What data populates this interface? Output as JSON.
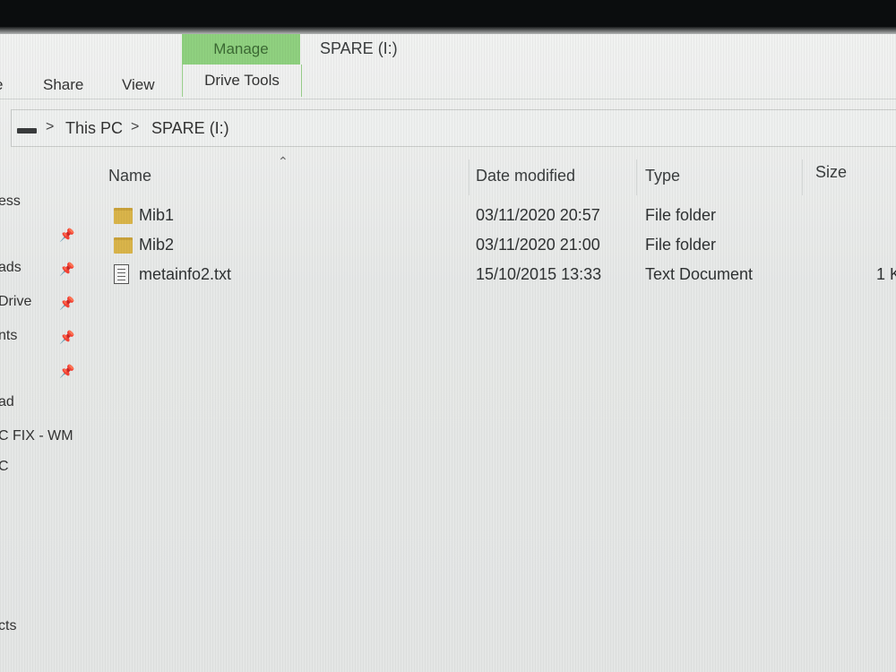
{
  "window": {
    "title": "SPARE (I:)"
  },
  "ribbon": {
    "context_group": "Manage",
    "context_tab": "Drive Tools",
    "tabs": [
      "e",
      "Share",
      "View"
    ]
  },
  "address": {
    "crumbs": [
      "This PC",
      "SPARE (I:)"
    ],
    "separator": ">"
  },
  "nav": {
    "items": [
      {
        "label": "ess",
        "pinned": false
      },
      {
        "label": "",
        "pinned": true
      },
      {
        "label": "ads",
        "pinned": true
      },
      {
        "label": "Drive",
        "pinned": true
      },
      {
        "label": "nts",
        "pinned": true
      },
      {
        "label": "",
        "pinned": true
      },
      {
        "label": "ad",
        "pinned": false
      },
      {
        "label": "C FIX - WM",
        "pinned": false
      },
      {
        "label": "C",
        "pinned": false
      },
      {
        "label": "cts",
        "pinned": false
      }
    ],
    "pin_icon": "pin-icon"
  },
  "columns": {
    "name": "Name",
    "date": "Date modified",
    "type": "Type",
    "size": "Size"
  },
  "files": [
    {
      "name": "Mib1",
      "date": "03/11/2020 20:57",
      "type": "File folder",
      "size": "",
      "icon": "folder-icon"
    },
    {
      "name": "Mib2",
      "date": "03/11/2020 21:00",
      "type": "File folder",
      "size": "",
      "icon": "folder-icon"
    },
    {
      "name": "metainfo2.txt",
      "date": "15/10/2015 13:33",
      "type": "Text Document",
      "size": "1 K",
      "icon": "text-document-icon"
    }
  ],
  "colors": {
    "manage_tab": "#8fd07f",
    "folder": "#d9b44a"
  }
}
